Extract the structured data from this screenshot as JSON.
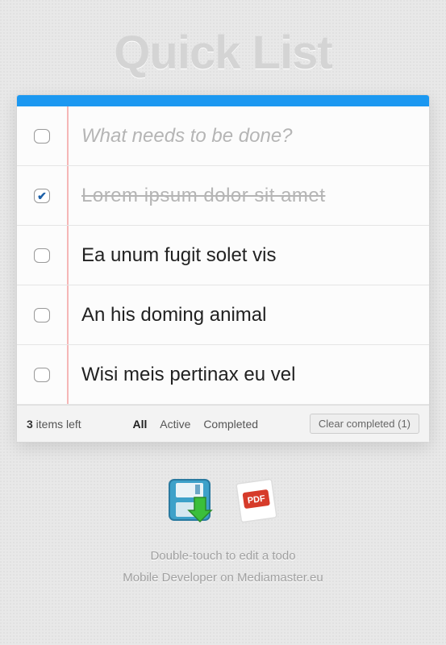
{
  "app": {
    "title": "Quick List"
  },
  "newTodo": {
    "placeholder": "What needs to be done?"
  },
  "todos": [
    {
      "text": "Lorem ipsum dolor sit amet",
      "completed": true
    },
    {
      "text": "Ea unum fugit solet vis",
      "completed": false
    },
    {
      "text": "An his doming animal",
      "completed": false
    },
    {
      "text": "Wisi meis pertinax eu vel",
      "completed": false
    }
  ],
  "footer": {
    "itemsCount": "3",
    "itemsSuffix": " items left",
    "filters": {
      "all": "All",
      "active": "Active",
      "completed": "Completed"
    },
    "activeFilter": "all",
    "clearLabel": "Clear completed (1)"
  },
  "bottom": {
    "hint": "Double-touch to edit a todo",
    "credit": "Mobile Developer on Mediamaster.eu"
  }
}
